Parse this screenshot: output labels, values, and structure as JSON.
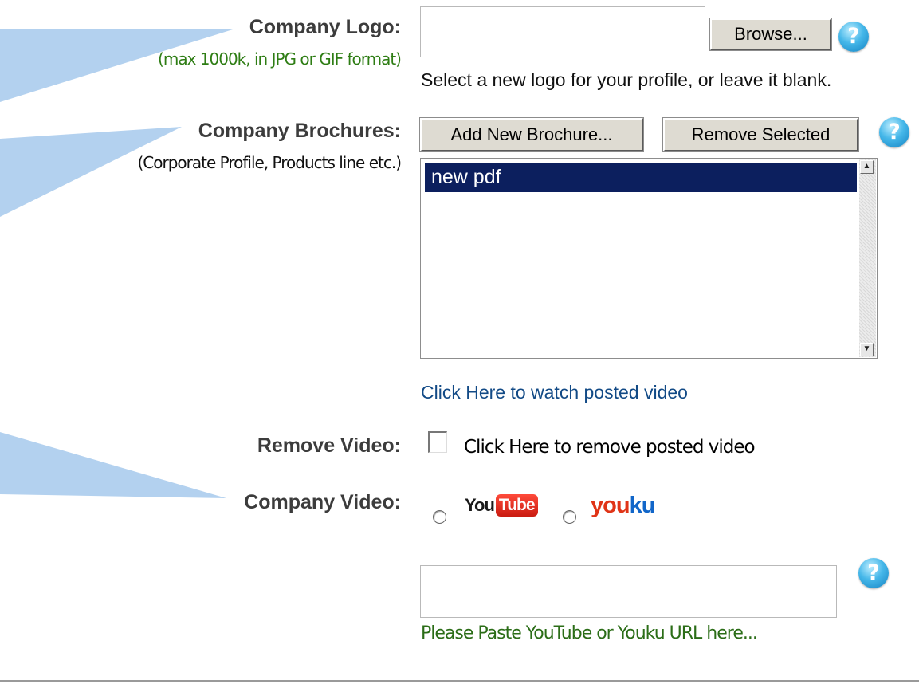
{
  "colors": {
    "callout": "#b3d1ef",
    "list_selected_bg": "#0c1f5e",
    "link": "#124a86",
    "note_green": "#2e7d14",
    "help_icon": "#45b7e9"
  },
  "logo_section": {
    "label": "Company Logo:",
    "sublabel": "(max 1000k, in JPG or GIF format)",
    "file_input_value": "",
    "browse_label": "Browse...",
    "hint": "Select a new logo for your profile, or leave it blank.",
    "help_icon": "help-question-icon",
    "help_glyph": "?"
  },
  "brochure_section": {
    "label": "Company Brochures:",
    "sublabel": "(Corporate Profile, Products line etc.)",
    "add_label": "Add New Brochure...",
    "remove_label": "Remove Selected",
    "help_glyph": "?",
    "items": [
      "new pdf"
    ],
    "scroll_up_glyph": "▲",
    "scroll_down_glyph": "▼"
  },
  "video": {
    "watch_link": "Click Here to watch posted video",
    "remove_label": "Remove Video:",
    "remove_checkbox_label": "Click Here to remove posted video",
    "remove_checked": false,
    "company_video_label": "Company Video:",
    "options": [
      {
        "name": "YouTube",
        "logo_part1": "You",
        "logo_part2": "Tube",
        "selected": false
      },
      {
        "name": "Youku",
        "logo_part1": "you",
        "logo_part2": "ku",
        "selected": false
      }
    ],
    "url_value": "",
    "url_note": "Please Paste YouTube or Youku URL here...",
    "help_glyph": "?"
  }
}
